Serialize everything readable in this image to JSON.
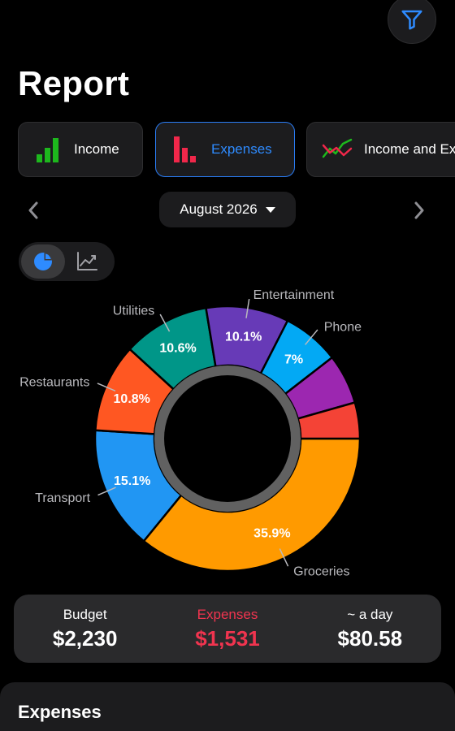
{
  "header": {
    "title": "Report",
    "filter_icon": "filter-icon"
  },
  "tabs": [
    {
      "label": "Income",
      "icon": "bar-chart-icon",
      "color": "#1db81d",
      "active": false
    },
    {
      "label": "Expenses",
      "icon": "bar-chart-icon",
      "color": "#f0274a",
      "active": true
    },
    {
      "label": "Income and Ex",
      "icon": "trend-lines-icon",
      "active": false
    }
  ],
  "period": {
    "label": "August 2026",
    "prev_icon": "chevron-left-icon",
    "next_icon": "chevron-right-icon"
  },
  "view_toggle": {
    "options": [
      "pie-chart-icon",
      "line-chart-icon"
    ],
    "selected": "pie-chart-icon"
  },
  "chart_data": {
    "type": "pie",
    "style": "donut",
    "slices": [
      {
        "name": "Groceries",
        "value": 35.9,
        "label": "35.9%",
        "color": "#ff9a00"
      },
      {
        "name": "Transport",
        "value": 15.1,
        "label": "15.1%",
        "color": "#2196f3"
      },
      {
        "name": "Restaurants",
        "value": 10.8,
        "label": "10.8%",
        "color": "#ff5722"
      },
      {
        "name": "Utilities",
        "value": 10.6,
        "label": "10.6%",
        "color": "#009688"
      },
      {
        "name": "Entertainment",
        "value": 10.1,
        "label": "10.1%",
        "color": "#673ab7"
      },
      {
        "name": "Phone",
        "value": 7,
        "label": "7%",
        "color": "#03a9f4"
      },
      {
        "name": "",
        "value": 6.1,
        "label": "",
        "color": "#9c27b0"
      },
      {
        "name": "",
        "value": 4.4,
        "label": "",
        "color": "#f44336"
      }
    ]
  },
  "summary": {
    "budget": {
      "label": "Budget",
      "value": "$2,230"
    },
    "expenses": {
      "label": "Expenses",
      "value": "$1,531"
    },
    "per_day": {
      "label": "~ a day",
      "value": "$80.58"
    }
  },
  "section": {
    "title": "Expenses"
  }
}
